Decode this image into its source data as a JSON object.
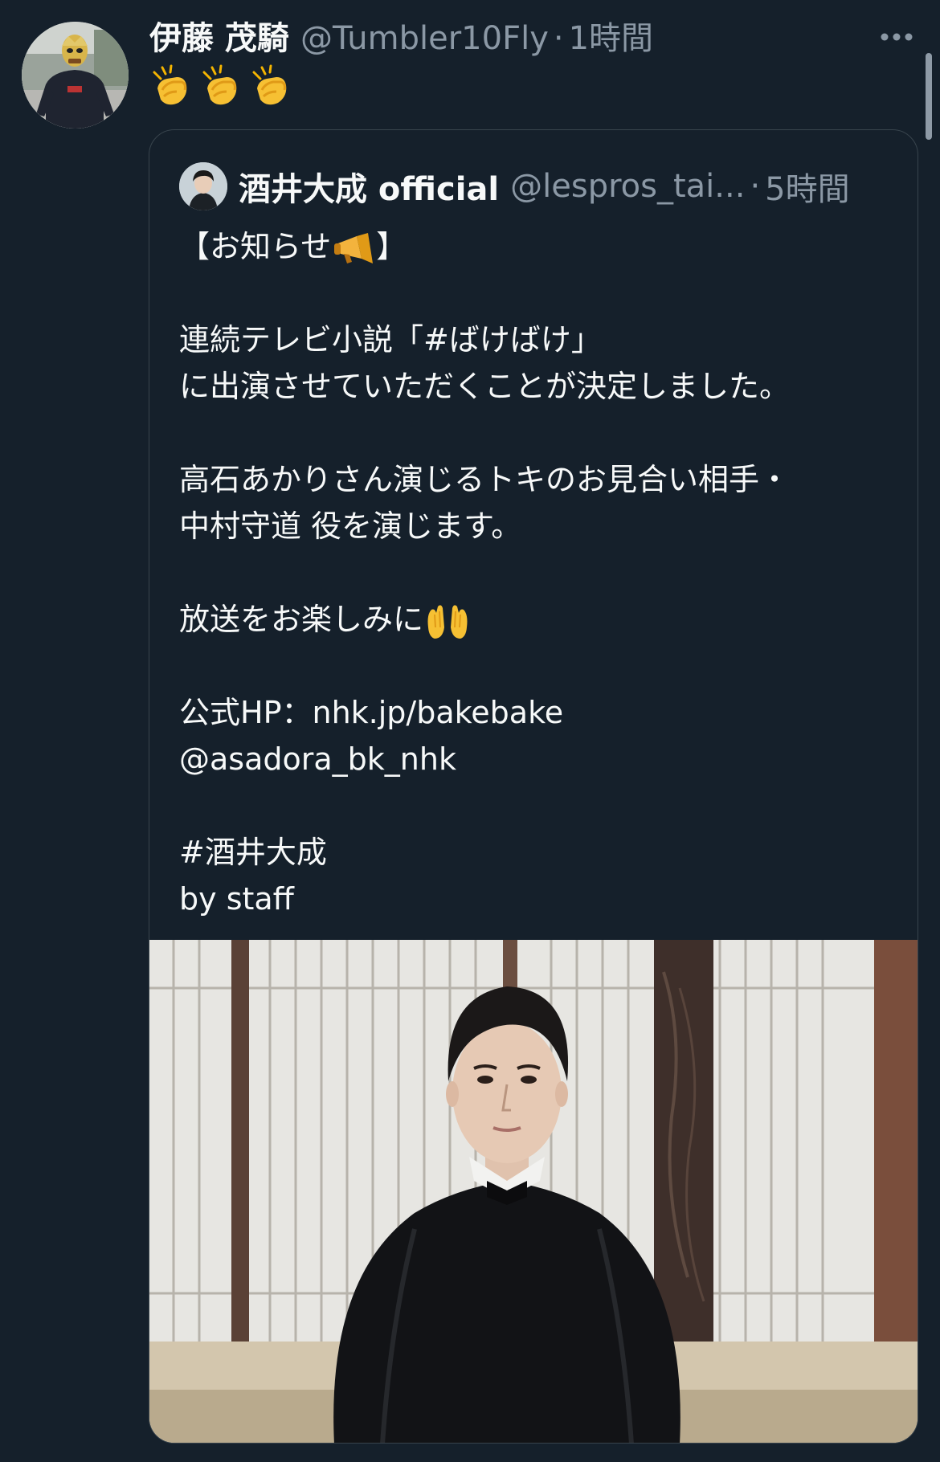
{
  "tweet": {
    "author": {
      "name": "伊藤 茂騎",
      "handle": "@Tumbler10Fly",
      "time": "1時間"
    },
    "text_emojis": [
      "clapping-hands",
      "clapping-hands",
      "clapping-hands"
    ],
    "more_icon": "more-horizontal-icon"
  },
  "quote": {
    "author": {
      "name": "酒井大成 official",
      "handle": "@lespros_tai...",
      "time": "5時間"
    },
    "body_lines": [
      "【お知らせ",
      "",
      "連続テレビ小説「#ばけばけ」",
      "に出演させていただくことが決定しました。",
      "",
      "高石あかりさん演じるトキのお見合い相手・",
      "中村守道 役を演じます。",
      "",
      "放送をお楽しみに",
      "",
      "公式HP：nhk.jp/bakebake",
      "@asadora_bk_nhk",
      "",
      "#酒井大成",
      "by staff"
    ],
    "body_line_suffixes": {
      "0": "】"
    },
    "inline_emojis": {
      "0": "megaphone",
      "8": "raised-palms"
    },
    "media": {
      "description_icon": "photo-icon"
    }
  },
  "colors": {
    "background": "#15202b",
    "text": "#f7f9f9",
    "secondary": "#8b98a5",
    "border": "#38444d"
  }
}
